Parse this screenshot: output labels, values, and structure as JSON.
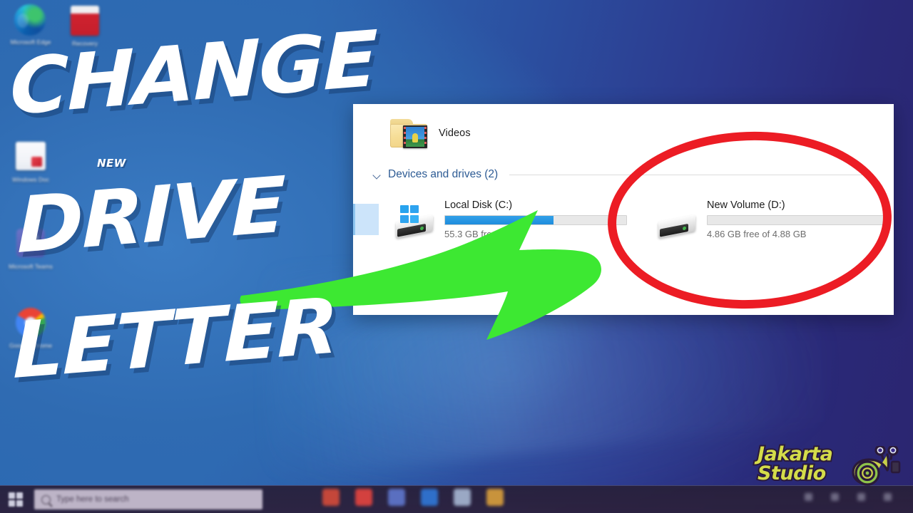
{
  "thumbnail": {
    "title_lines": [
      "CHANGE",
      "DRIVE",
      "LETTER"
    ],
    "badge": "NEW",
    "title_color": "#FFFFFF",
    "shadow_color": "#14376 9",
    "background": {
      "left_color": "#2B6AB3",
      "right_color": "#2B2570",
      "description": "Windows 10 desktop wallpaper blue to indigo gradient"
    }
  },
  "desktop": {
    "icons": [
      {
        "name": "Microsoft Edge",
        "caption": "Microsoft Edge",
        "icon": "edge-icon"
      },
      {
        "name": "Recycle / Red Doc",
        "caption": "Recovery",
        "icon": "red-document-icon"
      },
      {
        "name": "Windows Document",
        "caption": "Windows Doc",
        "icon": "windows-document-icon"
      },
      {
        "name": "Teams",
        "caption": "Microsoft Teams",
        "icon": "teams-icon"
      },
      {
        "name": "Google Chrome",
        "caption": "Google Chrome",
        "icon": "chrome-icon"
      }
    ]
  },
  "explorer": {
    "quick_item": {
      "label": "Videos",
      "icon": "videos-folder-icon"
    },
    "section": {
      "label": "Devices and drives (2)",
      "chevron": "chevron-down-icon",
      "expanded": true
    },
    "drives": [
      {
        "name": "Local Disk (C:)",
        "icon": "windows-drive-icon",
        "free_text": "55.3 GB free of",
        "usage_percent": 60,
        "bar_fill_color": "#1F8DDD",
        "bar_track_color": "#E8E8E8"
      },
      {
        "name": "New Volume (D:)",
        "icon": "hard-drive-icon",
        "free_text": "4.86 GB free of 4.88 GB",
        "usage_percent": 0,
        "bar_fill_color": "#1F8DDD",
        "bar_track_color": "#E8E8E8"
      }
    ]
  },
  "annotations": {
    "ellipse": {
      "shape": "ellipse",
      "color": "#EC1C24",
      "target": "New Volume (D:)"
    },
    "arrow": {
      "shape": "curved-arrow",
      "color": "#3DE832",
      "direction": "right"
    }
  },
  "taskbar": {
    "start_button": "windows-start-icon",
    "search_placeholder": "Type here to search",
    "search_icon": "search-icon",
    "apps": [
      {
        "name": "chrome-taskbar-icon",
        "color": "#c4473a"
      },
      {
        "name": "recorder-taskbar-icon",
        "color": "#d3413f"
      },
      {
        "name": "explorer-taskbar-icon",
        "color": "#5a6fc0"
      },
      {
        "name": "store-taskbar-icon",
        "color": "#2f6fc9"
      },
      {
        "name": "word-taskbar-icon",
        "color": "#9aa8c4"
      },
      {
        "name": "folder-taskbar-icon",
        "color": "#c8933c"
      }
    ],
    "tray_items": [
      "network-icon",
      "volume-icon",
      "battery-icon",
      "notifications-icon"
    ]
  },
  "branding": {
    "line1": "Jakarta",
    "line2": "Studio",
    "mascot": "snail-icon",
    "text_color": "#D4DC4A",
    "outline_color": "#2A1A3A"
  }
}
